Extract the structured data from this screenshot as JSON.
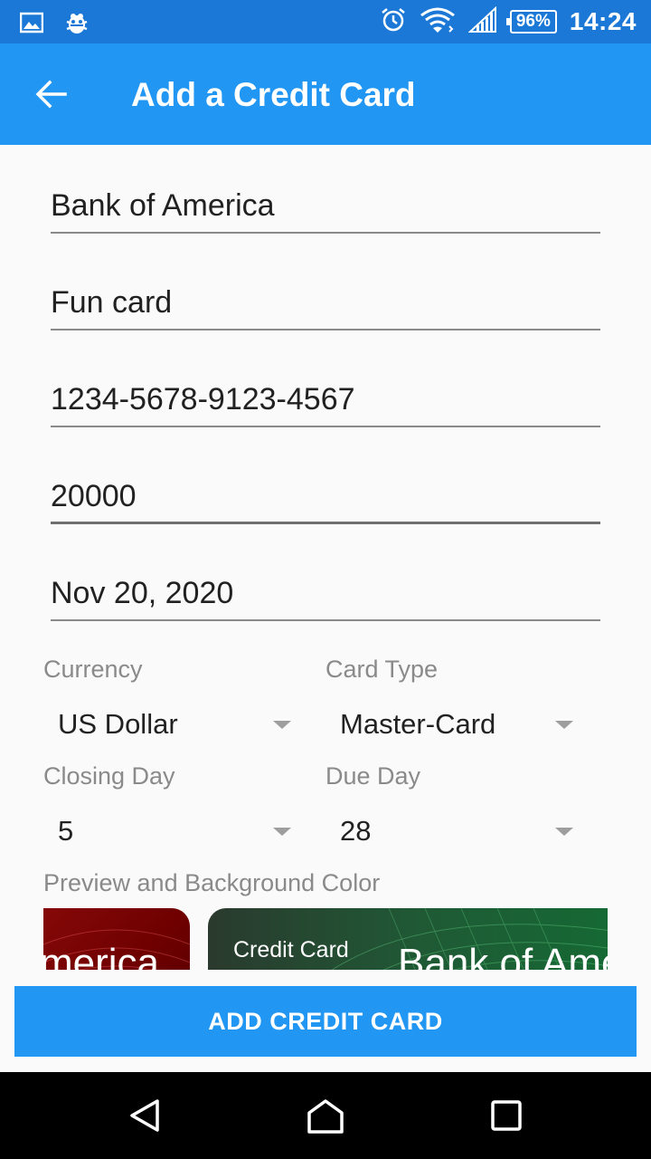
{
  "status_bar": {
    "battery": "96%",
    "time": "14:24"
  },
  "app_bar": {
    "title": "Add a Credit Card"
  },
  "form": {
    "bank_name": "Bank of America",
    "card_name": "Fun card",
    "card_number": "1234-5678-9123-4567",
    "credit_limit": "20000",
    "expiry_date": "Nov 20, 2020",
    "currency_label": "Currency",
    "currency_value": "US Dollar",
    "card_type_label": "Card Type",
    "card_type_value": "Master-Card",
    "closing_day_label": "Closing Day",
    "closing_day_value": "5",
    "due_day_label": "Due Day",
    "due_day_value": "28",
    "preview_label": "Preview and Background Color"
  },
  "preview_cards": [
    {
      "text": "merica",
      "color": "#7a0505"
    },
    {
      "small_text": "Credit Card",
      "big_text": "Bank of Ame",
      "color": "#1f5a35"
    }
  ],
  "actions": {
    "add_button_label": "ADD CREDIT CARD"
  },
  "colors": {
    "primary": "#2196f3",
    "status_bar": "#1b78d6"
  }
}
